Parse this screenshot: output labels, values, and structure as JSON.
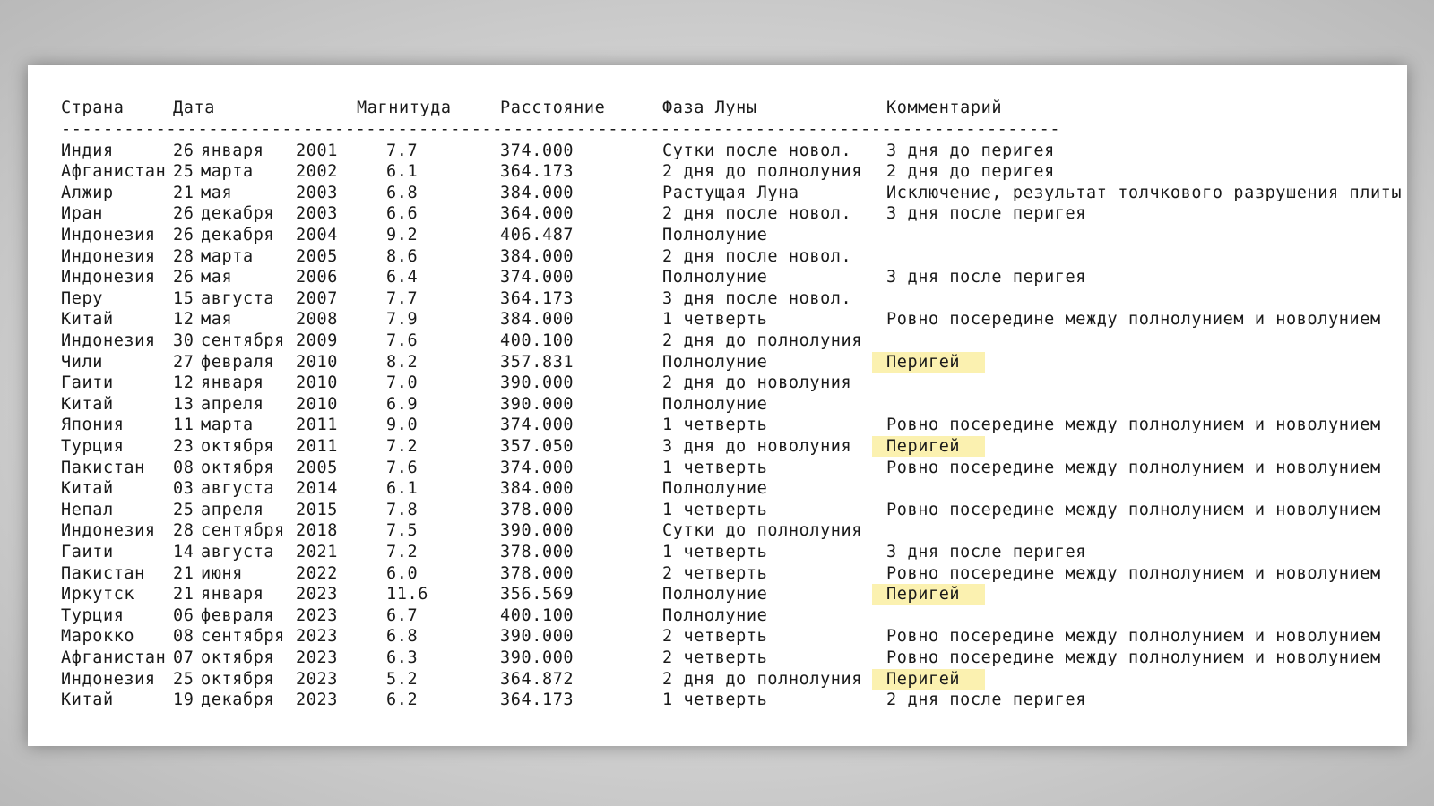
{
  "header": {
    "country": "Страна",
    "date": "Дата",
    "magnitude": "Магнитуда",
    "distance": "Расстояние",
    "phase": "Фаза Луны",
    "comment": "Комментарий"
  },
  "divider": "-----------------------------------------------------------------------------------------------",
  "highlight_color": "#fbf1b0",
  "rows": [
    {
      "country": "Индия",
      "day": "26",
      "month": "января",
      "year": "2001",
      "mag": "7.7",
      "dist": "374.000",
      "phase": "Сутки после новол.",
      "comment": "3 дня до перигея",
      "highlight": false
    },
    {
      "country": "Афганистан",
      "day": "25",
      "month": "марта",
      "year": "2002",
      "mag": "6.1",
      "dist": "364.173",
      "phase": "2 дня до полнолуния",
      "comment": "2 дня до перигея",
      "highlight": false
    },
    {
      "country": "Алжир",
      "day": "21",
      "month": "мая",
      "year": "2003",
      "mag": "6.8",
      "dist": "384.000",
      "phase": "Растущая Луна",
      "comment": "Исключение, результат толчкового разрушения плиты",
      "highlight": false
    },
    {
      "country": "Иран",
      "day": "26",
      "month": "декабря",
      "year": "2003",
      "mag": "6.6",
      "dist": "364.000",
      "phase": "2 дня после новол.",
      "comment": "3 дня после перигея",
      "highlight": false
    },
    {
      "country": "Индонезия",
      "day": "26",
      "month": "декабря",
      "year": "2004",
      "mag": "9.2",
      "dist": "406.487",
      "phase": "Полнолуние",
      "comment": "",
      "highlight": false
    },
    {
      "country": "Индонезия",
      "day": "28",
      "month": "марта",
      "year": "2005",
      "mag": "8.6",
      "dist": "384.000",
      "phase": "2 дня после новол.",
      "comment": "",
      "highlight": false
    },
    {
      "country": "Индонезия",
      "day": "26",
      "month": "мая",
      "year": "2006",
      "mag": "6.4",
      "dist": "374.000",
      "phase": "Полнолуние",
      "comment": "3 дня после перигея",
      "highlight": false
    },
    {
      "country": "Перу",
      "day": "15",
      "month": "августа",
      "year": "2007",
      "mag": "7.7",
      "dist": "364.173",
      "phase": "3 дня после новол.",
      "comment": "",
      "highlight": false
    },
    {
      "country": "Китай",
      "day": "12",
      "month": "мая",
      "year": "2008",
      "mag": "7.9",
      "dist": "384.000",
      "phase": "1 четверть",
      "comment": "Ровно посередине между полнолунием и новолунием",
      "highlight": false
    },
    {
      "country": "Индонезия",
      "day": "30",
      "month": "сентября",
      "year": "2009",
      "mag": "7.6",
      "dist": "400.100",
      "phase": "2 дня до полнолуния",
      "comment": "",
      "highlight": false
    },
    {
      "country": "Чили",
      "day": "27",
      "month": "февраля",
      "year": "2010",
      "mag": "8.2",
      "dist": "357.831",
      "phase": "Полнолуние",
      "comment": "Перигей",
      "highlight": true
    },
    {
      "country": "Гаити",
      "day": "12",
      "month": "января",
      "year": "2010",
      "mag": "7.0",
      "dist": "390.000",
      "phase": "2 дня до новолуния",
      "comment": "",
      "highlight": false
    },
    {
      "country": "Китай",
      "day": "13",
      "month": "апреля",
      "year": "2010",
      "mag": "6.9",
      "dist": "390.000",
      "phase": "Полнолуние",
      "comment": "",
      "highlight": false
    },
    {
      "country": "Япония",
      "day": "11",
      "month": "марта",
      "year": "2011",
      "mag": "9.0",
      "dist": "374.000",
      "phase": "1 четверть",
      "comment": "Ровно посередине между полнолунием и новолунием",
      "highlight": false
    },
    {
      "country": "Турция",
      "day": "23",
      "month": "октября",
      "year": "2011",
      "mag": "7.2",
      "dist": "357.050",
      "phase": "3 дня до новолуния",
      "comment": "Перигей",
      "highlight": true
    },
    {
      "country": "Пакистан",
      "day": "08",
      "month": "октября",
      "year": "2005",
      "mag": "7.6",
      "dist": "374.000",
      "phase": "1 четверть",
      "comment": "Ровно посередине между полнолунием и новолунием",
      "highlight": false
    },
    {
      "country": "Китай",
      "day": "03",
      "month": "августа",
      "year": "2014",
      "mag": "6.1",
      "dist": "384.000",
      "phase": "Полнолуние",
      "comment": "",
      "highlight": false
    },
    {
      "country": "Непал",
      "day": "25",
      "month": "апреля",
      "year": "2015",
      "mag": "7.8",
      "dist": "378.000",
      "phase": "1 четверть",
      "comment": "Ровно посередине между полнолунием и новолунием",
      "highlight": false
    },
    {
      "country": "Индонезия",
      "day": "28",
      "month": "сентября",
      "year": "2018",
      "mag": "7.5",
      "dist": "390.000",
      "phase": "Сутки до полнолуния",
      "comment": "",
      "highlight": false
    },
    {
      "country": "Гаити",
      "day": "14",
      "month": "августа",
      "year": "2021",
      "mag": "7.2",
      "dist": "378.000",
      "phase": "1 четверть",
      "comment": "3 дня после перигея",
      "highlight": false
    },
    {
      "country": "Пакистан",
      "day": "21",
      "month": "июня",
      "year": "2022",
      "mag": "6.0",
      "dist": "378.000",
      "phase": "2 четверть",
      "comment": "Ровно посередине между полнолунием и новолунием",
      "highlight": false
    },
    {
      "country": "Иркутск",
      "day": "21",
      "month": "января",
      "year": "2023",
      "mag": "11.6",
      "dist": "356.569",
      "phase": "Полнолуние",
      "comment": "Перигей",
      "highlight": true
    },
    {
      "country": "Турция",
      "day": "06",
      "month": "февраля",
      "year": "2023",
      "mag": "6.7",
      "dist": "400.100",
      "phase": "Полнолуние",
      "comment": "",
      "highlight": false
    },
    {
      "country": "Марокко",
      "day": "08",
      "month": "сентября",
      "year": "2023",
      "mag": "6.8",
      "dist": "390.000",
      "phase": "2 четверть",
      "comment": "Ровно посередине между полнолунием и новолунием",
      "highlight": false
    },
    {
      "country": "Афганистан",
      "day": "07",
      "month": "октября",
      "year": "2023",
      "mag": "6.3",
      "dist": "390.000",
      "phase": "2 четверть",
      "comment": "Ровно посередине между полнолунием и новолунием",
      "highlight": false
    },
    {
      "country": "Индонезия",
      "day": "25",
      "month": "октября",
      "year": "2023",
      "mag": "5.2",
      "dist": "364.872",
      "phase": "2 дня до полнолуния",
      "comment": "Перигей",
      "highlight": true
    },
    {
      "country": "Китай",
      "day": "19",
      "month": "декабря",
      "year": "2023",
      "mag": "6.2",
      "dist": "364.173",
      "phase": "1 четверть",
      "comment": "2 дня после перигея",
      "highlight": false
    }
  ]
}
